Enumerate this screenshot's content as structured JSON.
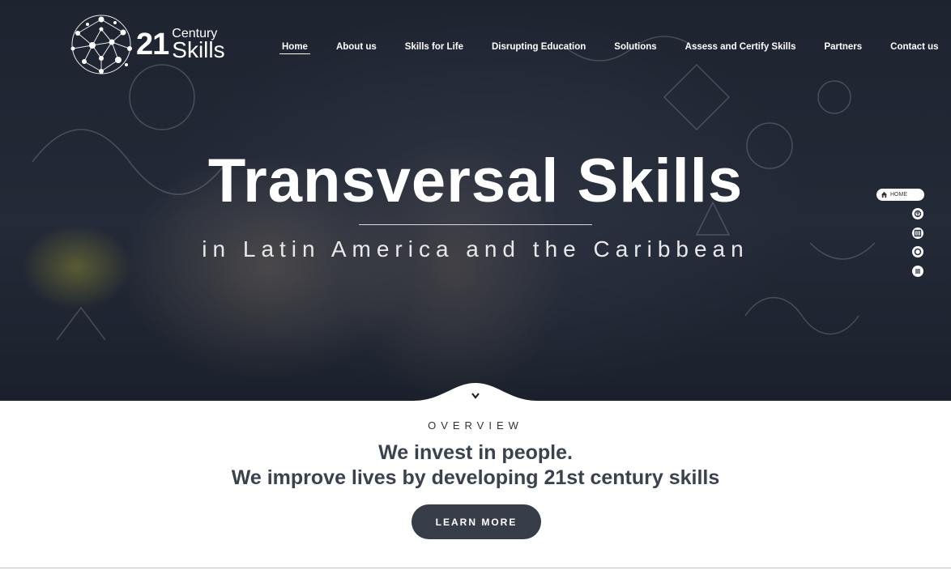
{
  "logo": {
    "number": "21",
    "word1": "Century",
    "word2": "Skills"
  },
  "nav": {
    "items": [
      "Home",
      "About us",
      "Skills for Life",
      "Disrupting Education",
      "Solutions",
      "Assess and Certify Skills",
      "Partners",
      "Contact us"
    ],
    "active": "Home"
  },
  "hero": {
    "title": "Transversal Skills",
    "subtitle": "in Latin America and the Caribbean"
  },
  "side_nav": {
    "home_label": "HOME",
    "icons": [
      "home-icon",
      "brain-icon",
      "books-icon",
      "circle-icon",
      "list-icon"
    ]
  },
  "overview": {
    "label": "OVERVIEW",
    "headline1": "We invest in people.",
    "headline2": "We improve lives by developing 21st century skills",
    "button": "LEARN MORE"
  },
  "colors": {
    "dark": "#363c48",
    "text": "#3b414d",
    "white": "#ffffff"
  }
}
